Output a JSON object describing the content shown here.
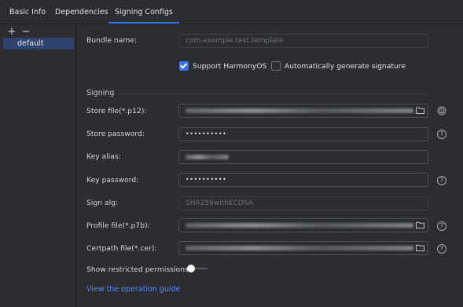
{
  "tabs": [
    {
      "label": "Basic Info",
      "active": false
    },
    {
      "label": "Dependencies",
      "active": false
    },
    {
      "label": "Signing Configs",
      "active": true
    }
  ],
  "left_panel": {
    "add_icon": "plus-icon",
    "remove_icon": "minus-icon",
    "items": [
      {
        "label": "default",
        "selected": true
      }
    ]
  },
  "form": {
    "bundle_name": {
      "label": "Bundle name:",
      "placeholder": "com.example.test.template"
    },
    "support_harmonyos": {
      "label": "Support HarmonyOS",
      "checked": true
    },
    "auto_signature": {
      "label": "Automatically generate signature",
      "checked": false
    },
    "signing_section": "Signing",
    "store_file": {
      "label": "Store file(*.p12):"
    },
    "store_password": {
      "label": "Store password:",
      "value": "••••••••••"
    },
    "key_alias": {
      "label": "Key alias:"
    },
    "key_password": {
      "label": "Key password:",
      "value": "••••••••••"
    },
    "sign_alg": {
      "label": "Sign alg:",
      "value": "SHA256withECDSA"
    },
    "profile_file": {
      "label": "Profile file(*.p7b):"
    },
    "certpath_file": {
      "label": "Certpath file(*.cer):"
    },
    "show_restricted": {
      "label": "Show restricted permissions",
      "enabled": false
    },
    "guide_link": "View the operation guide"
  },
  "icons": {
    "folder": "folder-icon",
    "help": "help-icon",
    "fingerprint": "fingerprint-icon"
  },
  "colors": {
    "accent": "#3574f0",
    "link": "#548af7",
    "background": "#2b2d30",
    "selection": "#2e436e"
  }
}
